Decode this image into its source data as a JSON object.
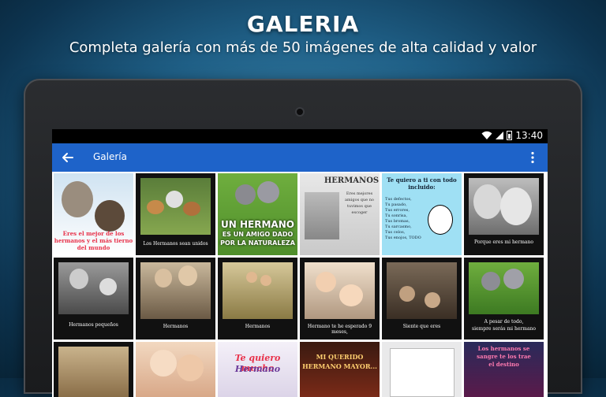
{
  "promo": {
    "title": "GALERIA",
    "subtitle": "Completa galería con más de 50 imágenes de alta calidad y valor"
  },
  "status_bar": {
    "time": "13:40"
  },
  "toolbar": {
    "title": "Galería"
  },
  "gallery": {
    "tiles": [
      {
        "caption": "Eres el mejor de los hermanos y el más tierno del mundo",
        "caption_color": "#e8324a"
      },
      {
        "caption": "Los Hermanos sean unidos"
      },
      {
        "caption_line1": "UN HERMANO",
        "caption_line2": "ES UN AMIGO DADO",
        "caption_line3": "POR LA NATURALEZA"
      },
      {
        "heading": "HERMANOS",
        "text": "Eres mejores amigos que no tuvimos que escoger"
      },
      {
        "heading": "Te quiero a ti con todo incluido:",
        "list": [
          "Tus defectos,",
          "Tu pasado,",
          "Tus errores,",
          "Tu sonrisa,",
          "Tus bromas,",
          "Tu sarcasmo,",
          "Tus celos,",
          "Tus enojos, TODO"
        ]
      },
      {
        "caption": "Porque eres mi hermano"
      },
      {
        "caption": "Hermanos pequeños"
      },
      {
        "caption": "Hermanos"
      },
      {
        "caption": "Hermanos"
      },
      {
        "caption": "Hermano te he esperado 9 meses,"
      },
      {
        "caption": "Siente que eres"
      },
      {
        "caption_line1": "A pesar de todo,",
        "caption_line2": "siempre serás mi hermano"
      },
      {
        "caption": ""
      },
      {
        "caption": ""
      },
      {
        "caption_line1": "Te quiero mucho",
        "caption_line2": "Hermano"
      },
      {
        "caption_line1": "MI QUERIDO",
        "caption_line2": "HERMANO MAYOR..."
      },
      {
        "caption": ""
      },
      {
        "caption_line1": "Los hermanos se",
        "caption_line2": "sangre te los trae",
        "caption_line3": "el destino"
      }
    ]
  },
  "icons": {
    "back": "arrow-left-icon",
    "menu": "more-vert-icon",
    "wifi": "wifi-icon",
    "signal": "signal-icon",
    "battery": "battery-icon"
  },
  "colors": {
    "toolbar": "#1e63c9",
    "accent_pink": "#e8324a"
  }
}
